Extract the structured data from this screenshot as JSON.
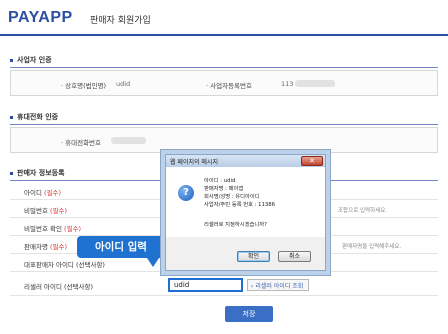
{
  "header": {
    "logo": "PAYAPP",
    "title": "판매자 회원가입"
  },
  "sections": {
    "business_auth": {
      "title": "사업자 인증",
      "company_label": "상호명(법인명)",
      "company_value": "udid",
      "bizno_label": "사업자등록번호",
      "bizno_value": "113"
    },
    "phone_auth": {
      "title": "휴대전화 인증",
      "phone_label": "휴대전화번호"
    },
    "seller_info": {
      "title": "판매자 정보등록",
      "rows": [
        {
          "label": "아이디",
          "req": "(필수)"
        },
        {
          "label": "비밀번호",
          "req": "(필수)"
        },
        {
          "label": "비밀번호 확인",
          "req": "(필수)"
        },
        {
          "label": "판매자명",
          "req": "(필수)"
        },
        {
          "label": "대표판매자 아이디 (선택사항)",
          "req": ""
        },
        {
          "label": "리셀러 아이디 (선택사항)",
          "req": ""
        }
      ],
      "hint_pw": "조합으로 입력하세요.",
      "hint_name": "판매자명을 입력해주세요.",
      "reseller_value": "udid",
      "reseller_inquiry": "리셀러 아이디 조회"
    }
  },
  "save_label": "저장",
  "callout": "아이디 입력",
  "dialog": {
    "title": "웹 페이지의 메시지",
    "close": "✕",
    "lines": [
      "아이디 : udid",
      "판매자명 : 페이앱",
      "회사명/성명 : 유디아이디",
      "사업자/주민 등록 번호 : 11386",
      "",
      "리셀러로 지정하시겠습니까?"
    ],
    "ok": "확인",
    "cancel": "취소"
  }
}
